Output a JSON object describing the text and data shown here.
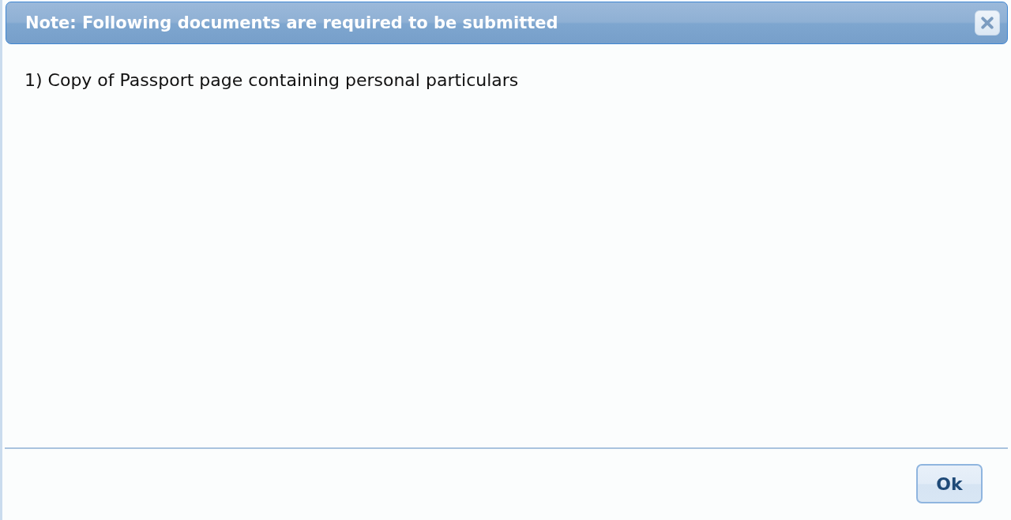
{
  "dialog": {
    "title": "Note: Following documents are required to be submitted",
    "items": [
      "1) Copy of Passport page containing personal particulars"
    ],
    "buttons": [
      {
        "label": "Ok"
      }
    ]
  }
}
